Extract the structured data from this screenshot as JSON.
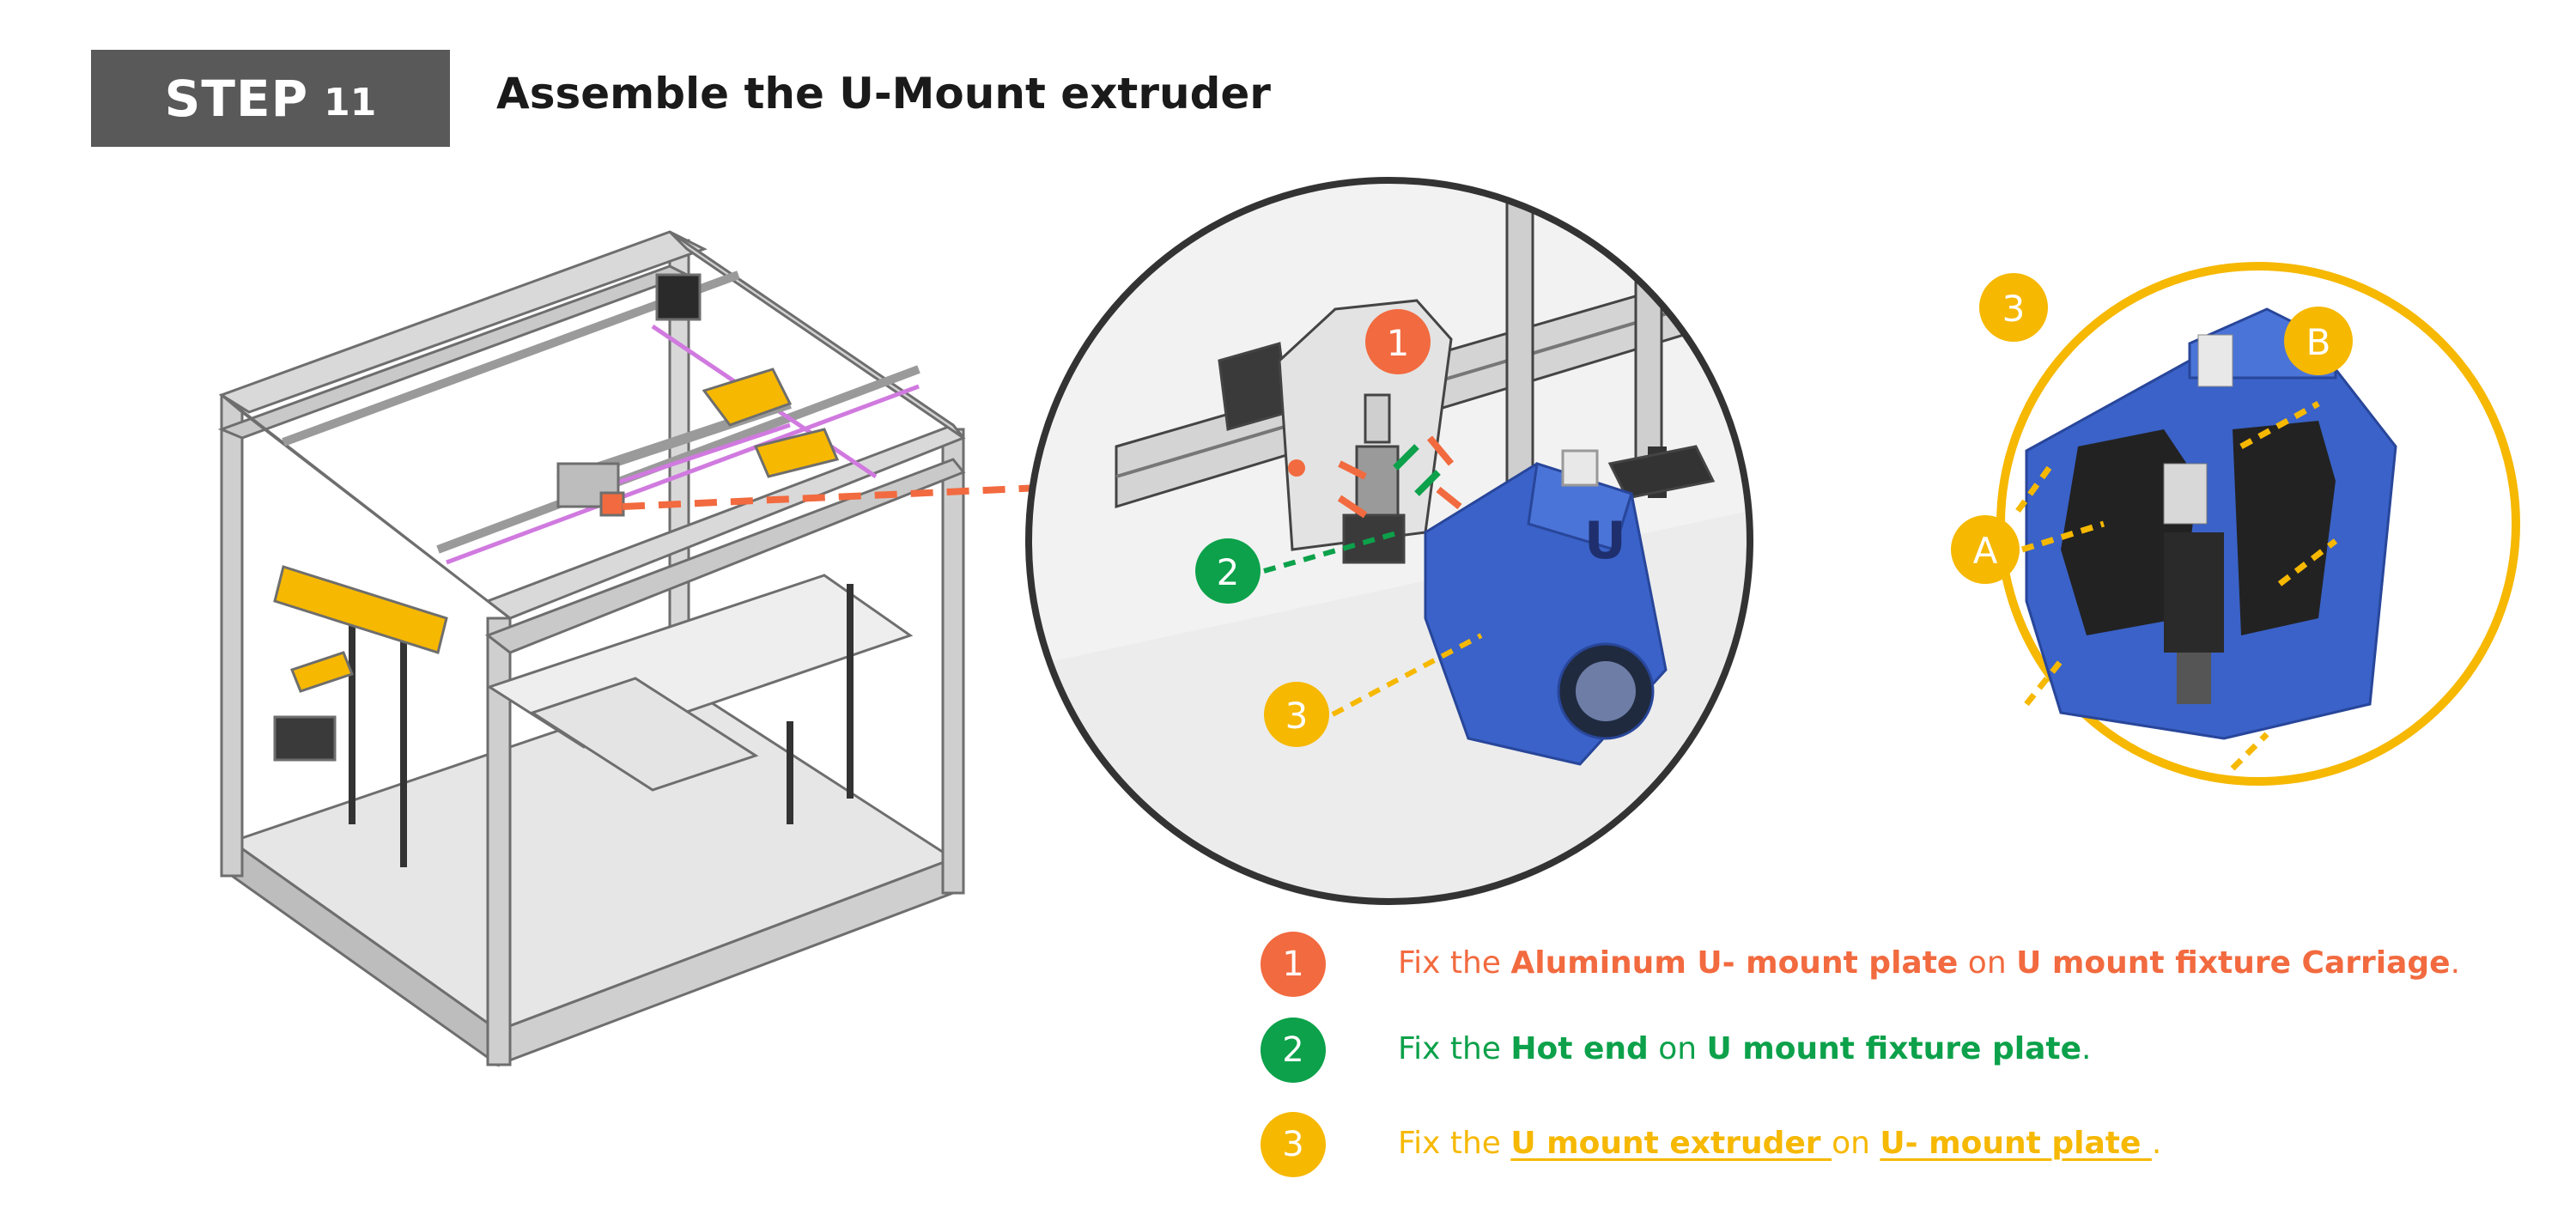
{
  "header": {
    "step_word": "STEP",
    "step_number": "11",
    "title": "Assemble the U-Mount extruder"
  },
  "callouts": {
    "orange": "1",
    "green": "2",
    "yellow": "3",
    "detail_number": "3",
    "label_a": "A",
    "label_b": "B"
  },
  "instructions": [
    {
      "number": "1",
      "color": "#f26a3f",
      "prefix": "Fix the ",
      "part1": "Aluminum U- mount plate",
      "middle": " on ",
      "part2": "U mount fixture Carriage",
      "suffix": "."
    },
    {
      "number": "2",
      "color": "#0ca14a",
      "prefix": "Fix the ",
      "part1": "Hot end",
      "middle": " on ",
      "part2": "U mount fixture plate",
      "suffix": "."
    },
    {
      "number": "3",
      "color": "#f6b800",
      "prefix": "Fix the ",
      "part1": "U mount extruder ",
      "middle": "on ",
      "part2": "U- mount plate ",
      "suffix": "."
    }
  ],
  "colors": {
    "orange": "#f26a3f",
    "green": "#0ca14a",
    "yellow": "#f6b800",
    "blue": "#3a62c8",
    "header_bg": "#595959"
  }
}
